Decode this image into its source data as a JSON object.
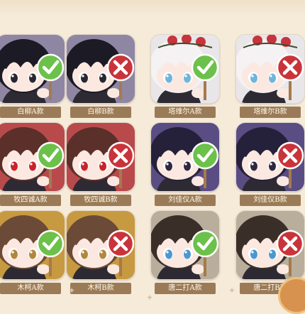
{
  "labels": {
    "c0": "白柳A款",
    "c1": "白柳B款",
    "c2": "塔维尔A款",
    "c3": "塔维尔B款",
    "c4": "牧四诚A款",
    "c5": "牧四诚B款",
    "c6": "刘佳仪A款",
    "c7": "刘佳仪B款",
    "c8": "木柯A款",
    "c9": "木柯B款",
    "c10": "唐二打A款",
    "c11": "唐二打B款"
  },
  "cards": [
    {
      "hair": "#1c1a24",
      "bg": "#8f86a4",
      "skin": "#fbe8e1",
      "eye": "#2a2730",
      "sign": "check",
      "roses": false
    },
    {
      "hair": "#1c1a24",
      "bg": "#8f86a4",
      "skin": "#fbe8e1",
      "eye": "#2a2730",
      "sign": "cross",
      "roses": false
    },
    {
      "hair": "#f4f2f2",
      "bg": "#e9e6ea",
      "skin": "#fbe8e1",
      "eye": "#6fb4d9",
      "sign": "check",
      "roses": true
    },
    {
      "hair": "#f4f2f2",
      "bg": "#e9e6ea",
      "skin": "#fbe8e1",
      "eye": "#6fb4d9",
      "sign": "cross",
      "roses": true
    },
    {
      "hair": "#5b2f2a",
      "bg": "#b94a4c",
      "skin": "#fbe8e1",
      "eye": "#c8242b",
      "sign": "check",
      "roses": false
    },
    {
      "hair": "#5b2f2a",
      "bg": "#b94a4c",
      "skin": "#fbe8e1",
      "eye": "#c8242b",
      "sign": "cross",
      "roses": false
    },
    {
      "hair": "#25213a",
      "bg": "#5a4d83",
      "skin": "#fbe8e1",
      "eye": "#30283f",
      "sign": "check",
      "roses": false
    },
    {
      "hair": "#25213a",
      "bg": "#5a4d83",
      "skin": "#fbe8e1",
      "eye": "#30283f",
      "sign": "cross",
      "roses": false
    },
    {
      "hair": "#6b4a37",
      "bg": "#c79a41",
      "skin": "#fbe8e1",
      "eye": "#b2873c",
      "sign": "check",
      "roses": false
    },
    {
      "hair": "#6b4a37",
      "bg": "#c79a41",
      "skin": "#fbe8e1",
      "eye": "#b2873c",
      "sign": "cross",
      "roses": false
    },
    {
      "hair": "#3a2f28",
      "bg": "#b9ae9c",
      "skin": "#fbe8e1",
      "eye": "#4a98cf",
      "sign": "check",
      "roses": false
    },
    {
      "hair": "#3a2f28",
      "bg": "#b9ae9c",
      "skin": "#fbe8e1",
      "eye": "#4a98cf",
      "sign": "cross",
      "roses": false
    }
  ],
  "colors": {
    "check": "#6cc14a",
    "cross": "#c9343a",
    "label_bg": "#9b7b57"
  }
}
